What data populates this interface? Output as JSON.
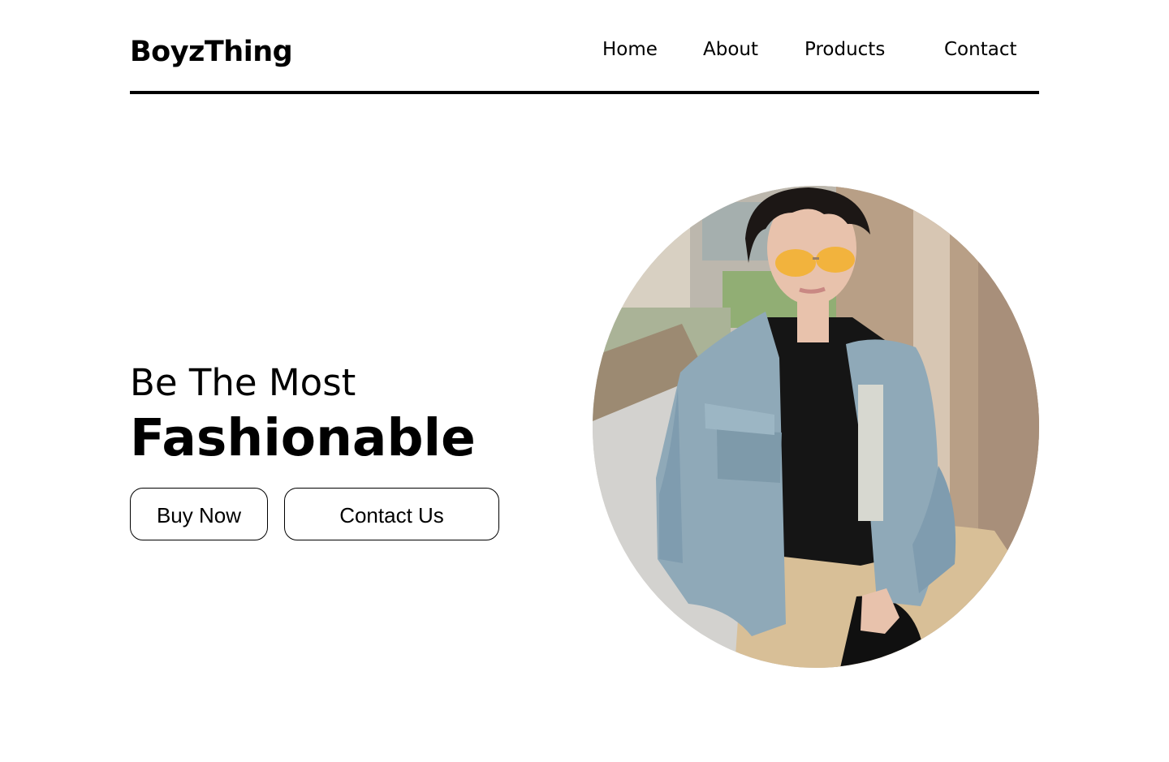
{
  "brand": {
    "name": "BoyzThing"
  },
  "nav": {
    "items": [
      {
        "label": "Home"
      },
      {
        "label": "About"
      },
      {
        "label": "Products"
      },
      {
        "label": "Contact"
      }
    ]
  },
  "hero": {
    "tagline": "Be The Most",
    "headline": "Fashionable",
    "buttons": {
      "buy_label": "Buy Now",
      "contact_label": "Contact Us"
    },
    "photo": {
      "icon": "model-photo",
      "colors": {
        "jacket": "#8fa9b8",
        "shirt": "#151515",
        "pants": "#d8bf97",
        "background": "#c9c3b8",
        "wall": "#b89f86",
        "glasses": "#f2b33d",
        "skin": "#e8c2ac"
      }
    }
  }
}
